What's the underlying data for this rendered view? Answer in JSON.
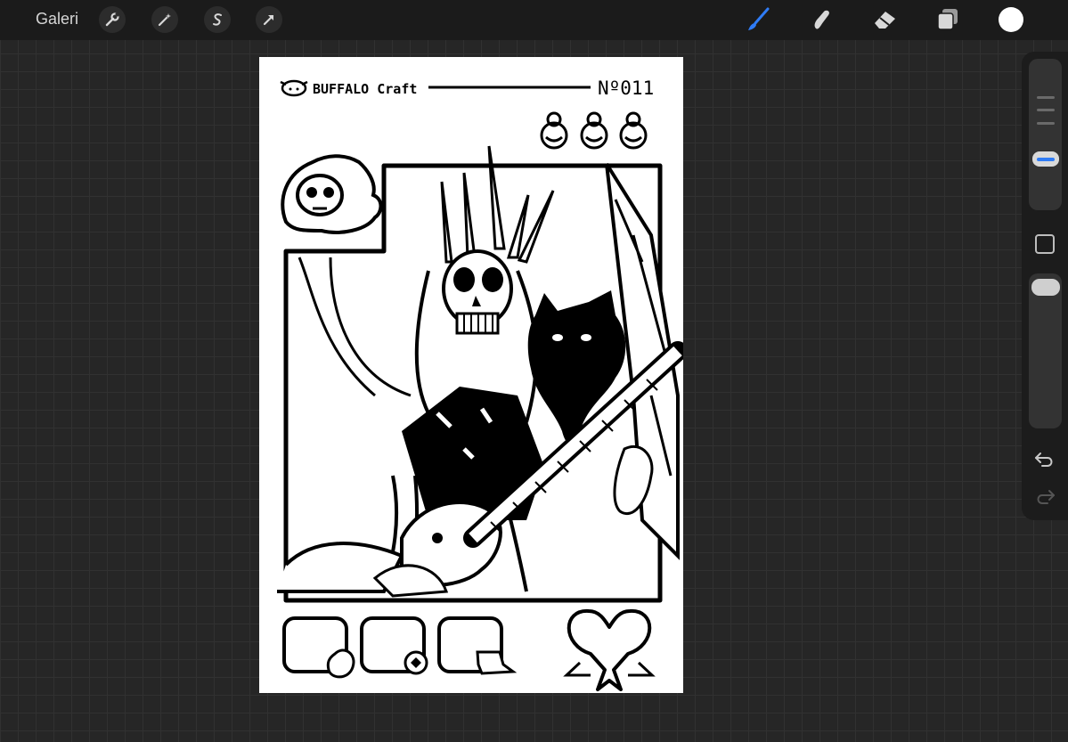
{
  "topbar": {
    "gallery_label": "Galeri",
    "left_tools": [
      "wrench-icon",
      "magic-wand-icon",
      "selection-s-icon",
      "transform-arrow-icon"
    ],
    "right_tools": [
      "brush-icon",
      "smudge-icon",
      "eraser-icon",
      "layers-icon"
    ],
    "active_tool": "brush-icon",
    "active_color": "#2f7cf6",
    "current_color": "#ffffff"
  },
  "sidebar": {
    "brush_size_level": 0.6,
    "opacity_level": 1.0,
    "controls": [
      "brush-size-slider",
      "modify-button",
      "opacity-slider",
      "undo-button",
      "redo-button"
    ]
  },
  "canvas": {
    "brand": "BUFFALO Craft",
    "card_number": "Nº011"
  },
  "colors": {
    "background": "#262626",
    "grid": "#313131",
    "toolbar": "#1b1b1b",
    "paper": "#ffffff",
    "ink": "#000000"
  }
}
